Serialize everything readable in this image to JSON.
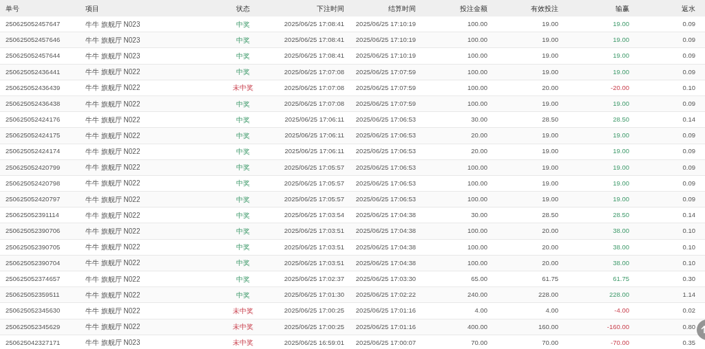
{
  "table": {
    "columns": [
      "单号",
      "项目",
      "状态",
      "下注时间",
      "结算时间",
      "投注金额",
      "有效投注",
      "输赢",
      "返水"
    ],
    "rows": [
      {
        "kind": "win",
        "cells": [
          "250625052457647",
          "牛牛 旗舰厅 N023",
          "中奖",
          "2025/06/25 17:08:41",
          "2025/06/25 17:10:19",
          "100.00",
          "19.00",
          "19.00",
          "0.09"
        ]
      },
      {
        "kind": "win",
        "cells": [
          "250625052457646",
          "牛牛 旗舰厅 N023",
          "中奖",
          "2025/06/25 17:08:41",
          "2025/06/25 17:10:19",
          "100.00",
          "19.00",
          "19.00",
          "0.09"
        ]
      },
      {
        "kind": "win",
        "cells": [
          "250625052457644",
          "牛牛 旗舰厅 N023",
          "中奖",
          "2025/06/25 17:08:41",
          "2025/06/25 17:10:19",
          "100.00",
          "19.00",
          "19.00",
          "0.09"
        ]
      },
      {
        "kind": "win",
        "cells": [
          "250625052436441",
          "牛牛 旗舰厅 N022",
          "中奖",
          "2025/06/25 17:07:08",
          "2025/06/25 17:07:59",
          "100.00",
          "19.00",
          "19.00",
          "0.09"
        ]
      },
      {
        "kind": "lose",
        "cells": [
          "250625052436439",
          "牛牛 旗舰厅 N022",
          "未中奖",
          "2025/06/25 17:07:08",
          "2025/06/25 17:07:59",
          "100.00",
          "20.00",
          "-20.00",
          "0.10"
        ]
      },
      {
        "kind": "win",
        "cells": [
          "250625052436438",
          "牛牛 旗舰厅 N022",
          "中奖",
          "2025/06/25 17:07:08",
          "2025/06/25 17:07:59",
          "100.00",
          "19.00",
          "19.00",
          "0.09"
        ]
      },
      {
        "kind": "win",
        "cells": [
          "250625052424176",
          "牛牛 旗舰厅 N022",
          "中奖",
          "2025/06/25 17:06:11",
          "2025/06/25 17:06:53",
          "30.00",
          "28.50",
          "28.50",
          "0.14"
        ]
      },
      {
        "kind": "win",
        "cells": [
          "250625052424175",
          "牛牛 旗舰厅 N022",
          "中奖",
          "2025/06/25 17:06:11",
          "2025/06/25 17:06:53",
          "20.00",
          "19.00",
          "19.00",
          "0.09"
        ]
      },
      {
        "kind": "win",
        "cells": [
          "250625052424174",
          "牛牛 旗舰厅 N022",
          "中奖",
          "2025/06/25 17:06:11",
          "2025/06/25 17:06:53",
          "20.00",
          "19.00",
          "19.00",
          "0.09"
        ]
      },
      {
        "kind": "win",
        "cells": [
          "250625052420799",
          "牛牛 旗舰厅 N022",
          "中奖",
          "2025/06/25 17:05:57",
          "2025/06/25 17:06:53",
          "100.00",
          "19.00",
          "19.00",
          "0.09"
        ]
      },
      {
        "kind": "win",
        "cells": [
          "250625052420798",
          "牛牛 旗舰厅 N022",
          "中奖",
          "2025/06/25 17:05:57",
          "2025/06/25 17:06:53",
          "100.00",
          "19.00",
          "19.00",
          "0.09"
        ]
      },
      {
        "kind": "win",
        "cells": [
          "250625052420797",
          "牛牛 旗舰厅 N022",
          "中奖",
          "2025/06/25 17:05:57",
          "2025/06/25 17:06:53",
          "100.00",
          "19.00",
          "19.00",
          "0.09"
        ]
      },
      {
        "kind": "win",
        "cells": [
          "250625052391114",
          "牛牛 旗舰厅 N022",
          "中奖",
          "2025/06/25 17:03:54",
          "2025/06/25 17:04:38",
          "30.00",
          "28.50",
          "28.50",
          "0.14"
        ]
      },
      {
        "kind": "win",
        "cells": [
          "250625052390706",
          "牛牛 旗舰厅 N022",
          "中奖",
          "2025/06/25 17:03:51",
          "2025/06/25 17:04:38",
          "100.00",
          "20.00",
          "38.00",
          "0.10"
        ]
      },
      {
        "kind": "win",
        "cells": [
          "250625052390705",
          "牛牛 旗舰厅 N022",
          "中奖",
          "2025/06/25 17:03:51",
          "2025/06/25 17:04:38",
          "100.00",
          "20.00",
          "38.00",
          "0.10"
        ]
      },
      {
        "kind": "win",
        "cells": [
          "250625052390704",
          "牛牛 旗舰厅 N022",
          "中奖",
          "2025/06/25 17:03:51",
          "2025/06/25 17:04:38",
          "100.00",
          "20.00",
          "38.00",
          "0.10"
        ]
      },
      {
        "kind": "win",
        "cells": [
          "250625052374657",
          "牛牛 旗舰厅 N022",
          "中奖",
          "2025/06/25 17:02:37",
          "2025/06/25 17:03:30",
          "65.00",
          "61.75",
          "61.75",
          "0.30"
        ]
      },
      {
        "kind": "win",
        "cells": [
          "250625052359511",
          "牛牛 旗舰厅 N022",
          "中奖",
          "2025/06/25 17:01:30",
          "2025/06/25 17:02:22",
          "240.00",
          "228.00",
          "228.00",
          "1.14"
        ]
      },
      {
        "kind": "lose",
        "cells": [
          "250625052345630",
          "牛牛 旗舰厅 N022",
          "未中奖",
          "2025/06/25 17:00:25",
          "2025/06/25 17:01:16",
          "4.00",
          "4.00",
          "-4.00",
          "0.02"
        ]
      },
      {
        "kind": "lose",
        "cells": [
          "250625052345629",
          "牛牛 旗舰厅 N022",
          "未中奖",
          "2025/06/25 17:00:25",
          "2025/06/25 17:01:16",
          "400.00",
          "160.00",
          "-160.00",
          "0.80"
        ]
      },
      {
        "kind": "lose",
        "cells": [
          "250625042327171",
          "牛牛 旗舰厅 N023",
          "未中奖",
          "2025/06/25 16:59:01",
          "2025/06/25 17:00:07",
          "70.00",
          "70.00",
          "-70.00",
          "0.35"
        ]
      }
    ]
  }
}
